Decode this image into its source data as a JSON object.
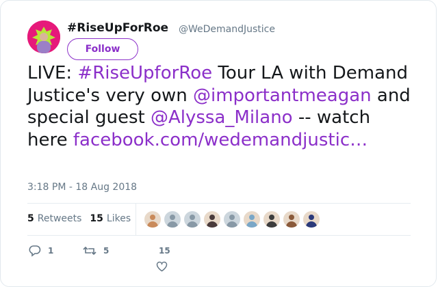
{
  "tweet": {
    "display_name": "#RiseUpForRoe",
    "handle": "@WeDemandJustice",
    "follow_label": "Follow",
    "text": {
      "live": "LIVE: ",
      "hashtag": "#RiseUpforRoe",
      "part2": " Tour LA with Demand Justice's very own ",
      "mention1": "@importantmeagan",
      "part3": " and special guest ",
      "mention2": "@Alyssa_Milano",
      "part4": " -- watch here ",
      "link": "facebook.com/wedemandjustic…"
    },
    "timestamp": "3:18 PM - 18 Aug 2018"
  },
  "stats": {
    "retweets_count": "5",
    "retweets_label": "Retweets",
    "likes_count": "15",
    "likes_label": "Likes"
  },
  "likers": [
    {
      "icon": "liker-avatar",
      "color": "#c98a5a"
    },
    {
      "icon": "default-avatar",
      "color": "#ccd6dd"
    },
    {
      "icon": "default-avatar",
      "color": "#ccd6dd"
    },
    {
      "icon": "liker-avatar",
      "color": "#4a3b3b"
    },
    {
      "icon": "default-avatar",
      "color": "#ccd6dd"
    },
    {
      "icon": "liker-avatar",
      "color": "#7aa7c7"
    },
    {
      "icon": "liker-avatar",
      "color": "#3d3d3d"
    },
    {
      "icon": "liker-avatar",
      "color": "#8a5a3a"
    },
    {
      "icon": "liker-avatar",
      "color": "#2b3a7a"
    }
  ],
  "actions": {
    "reply_count": "1",
    "retweet_count": "5",
    "like_count": "15"
  },
  "colors": {
    "accent": "#8b2fc9",
    "avatar_bg": "#e6197a",
    "muted": "#657786"
  }
}
